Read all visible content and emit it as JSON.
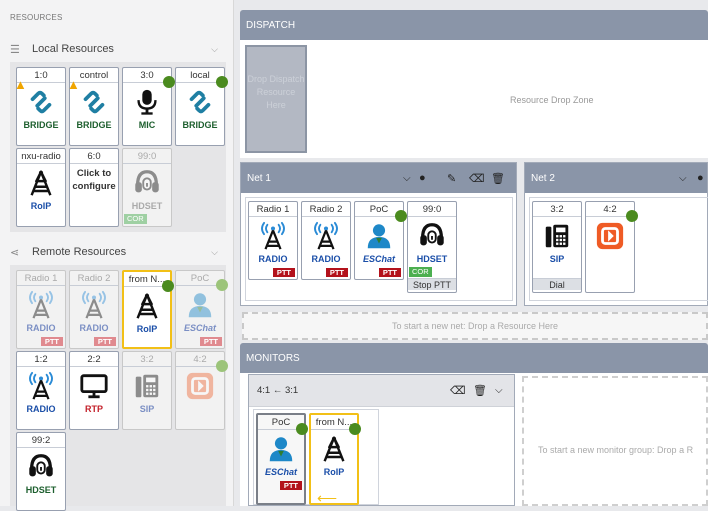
{
  "left": {
    "title": "RESOURCES",
    "local": {
      "label": "Local Resources",
      "tiles": [
        {
          "name": "1:0",
          "label": "BRIDGE"
        },
        {
          "name": "control",
          "label": "BRIDGE"
        },
        {
          "name": "3:0",
          "label": "MIC"
        },
        {
          "name": "local",
          "label": "BRIDGE"
        },
        {
          "name": "nxu-radio",
          "label": "RoIP"
        },
        {
          "name": "6:0",
          "config": "Click to configure"
        },
        {
          "name": "99:0",
          "label": "HDSET",
          "badge": "COR"
        }
      ]
    },
    "remote": {
      "label": "Remote Resources",
      "tiles": [
        {
          "name": "Radio 1",
          "label": "RADIO",
          "badge": "PTT"
        },
        {
          "name": "Radio 2",
          "label": "RADIO",
          "badge": "PTT"
        },
        {
          "name": "from N...",
          "label": "RoIP"
        },
        {
          "name": "PoC",
          "label": "ESChat",
          "badge": "PTT"
        },
        {
          "name": "1:2",
          "label": "RADIO"
        },
        {
          "name": "2:2",
          "label": "RTP"
        },
        {
          "name": "3:2",
          "label": "SIP"
        },
        {
          "name": "4:2",
          "label": ""
        },
        {
          "name": "99:2",
          "label": "HDSET"
        }
      ]
    }
  },
  "dispatch": {
    "title": "DISPATCH",
    "drop_tile": "Drop Dispatch Resource Here",
    "drop_zone": "Resource Drop Zone"
  },
  "net1": {
    "title": "Net 1",
    "tiles": [
      {
        "name": "Radio 1",
        "label": "RADIO",
        "badge": "PTT"
      },
      {
        "name": "Radio 2",
        "label": "RADIO",
        "badge": "PTT"
      },
      {
        "name": "PoC",
        "label": "ESChat",
        "badge": "PTT"
      },
      {
        "name": "99:0",
        "label": "HDSET",
        "badge": "COR",
        "action": "Stop PTT"
      }
    ]
  },
  "net2": {
    "title": "Net 2",
    "tiles": [
      {
        "name": "3:2",
        "label": "SIP",
        "action": "Dial"
      },
      {
        "name": "4:2",
        "label": ""
      }
    ]
  },
  "new_net": "To start a new net: Drop a Resource Here",
  "monitors": {
    "title": "MONITORS",
    "group_title": "4:1 ← 3:1",
    "tiles": [
      {
        "name": "PoC",
        "label": "ESChat",
        "badge": "PTT"
      },
      {
        "name": "from N...",
        "label": "RoIP"
      }
    ],
    "new_group": "To start a new monitor group: Drop a R"
  }
}
